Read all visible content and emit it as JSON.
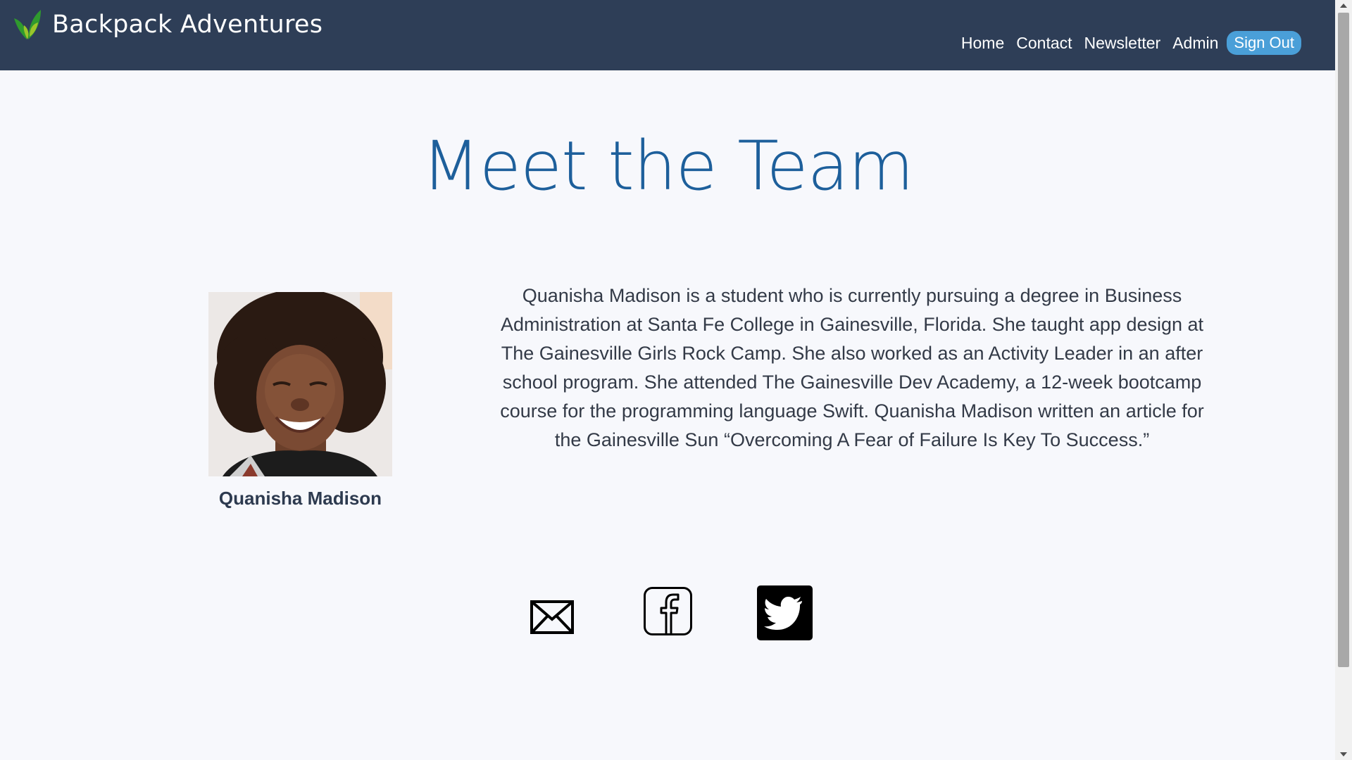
{
  "header": {
    "brand_name": "Backpack Adventures",
    "nav": {
      "home": "Home",
      "contact": "Contact",
      "newsletter": "Newsletter",
      "admin": "Admin",
      "sign_out": "Sign Out"
    }
  },
  "main": {
    "title": "Meet the Team",
    "member": {
      "name": "Quanisha Madison",
      "bio": "Quanisha Madison is a student who is currently pursuing a degree in Business Administration at Santa Fe College in Gainesville, Florida. She taught app design at The Gainesville Girls Rock Camp. She also worked as an Activity Leader in an after school program. She attended The Gainesville Dev Academy, a 12-week bootcamp course for the programming language Swift. Quanisha Madison written an article for the Gainesville Sun “Overcoming A Fear of Failure Is Key To Success.”"
    },
    "social": {
      "icons": [
        "envelope-icon",
        "facebook-icon",
        "twitter-icon"
      ]
    }
  },
  "colors": {
    "navbar_bg": "#2e3e57",
    "page_bg": "#f7f8fc",
    "title_blue": "#1d5f9b",
    "sign_out_bg": "#4a9fd8",
    "logo_green_dark": "#2f9a2e",
    "logo_green_light": "#9cc42a"
  }
}
